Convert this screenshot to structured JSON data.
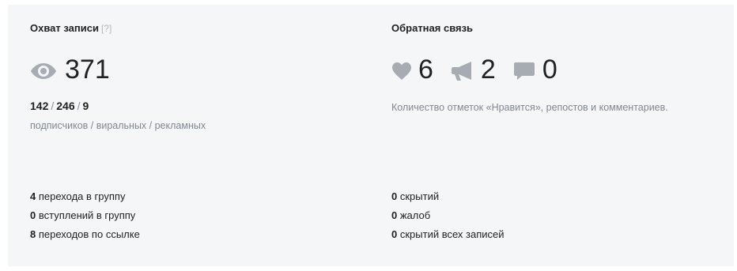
{
  "reach": {
    "title": "Охват записи",
    "hint": "[?]",
    "views": "371",
    "subscribers": "142",
    "viral": "246",
    "ads": "9",
    "separator": "/",
    "breakdown_label": "подписчиков / виральных / рекламных",
    "details": [
      {
        "value": "4",
        "label": "перехода в группу"
      },
      {
        "value": "0",
        "label": "вступлений в группу"
      },
      {
        "value": "8",
        "label": "переходов по ссылке"
      }
    ]
  },
  "feedback": {
    "title": "Обратная связь",
    "likes": "6",
    "reposts": "2",
    "comments": "0",
    "description": "Количество отметок «Нравится», репостов и комментариев.",
    "details": [
      {
        "value": "0",
        "label": "скрытий"
      },
      {
        "value": "0",
        "label": "жалоб"
      },
      {
        "value": "0",
        "label": "скрытий всех записей"
      }
    ]
  },
  "icons": {
    "views": "eye-icon",
    "likes": "heart-icon",
    "reposts": "megaphone-icon",
    "comments": "comment-icon"
  },
  "colors": {
    "panel_background": "#f5f6f8",
    "icon": "#a7acb2",
    "muted_text": "#828890",
    "primary_text": "#222222"
  }
}
